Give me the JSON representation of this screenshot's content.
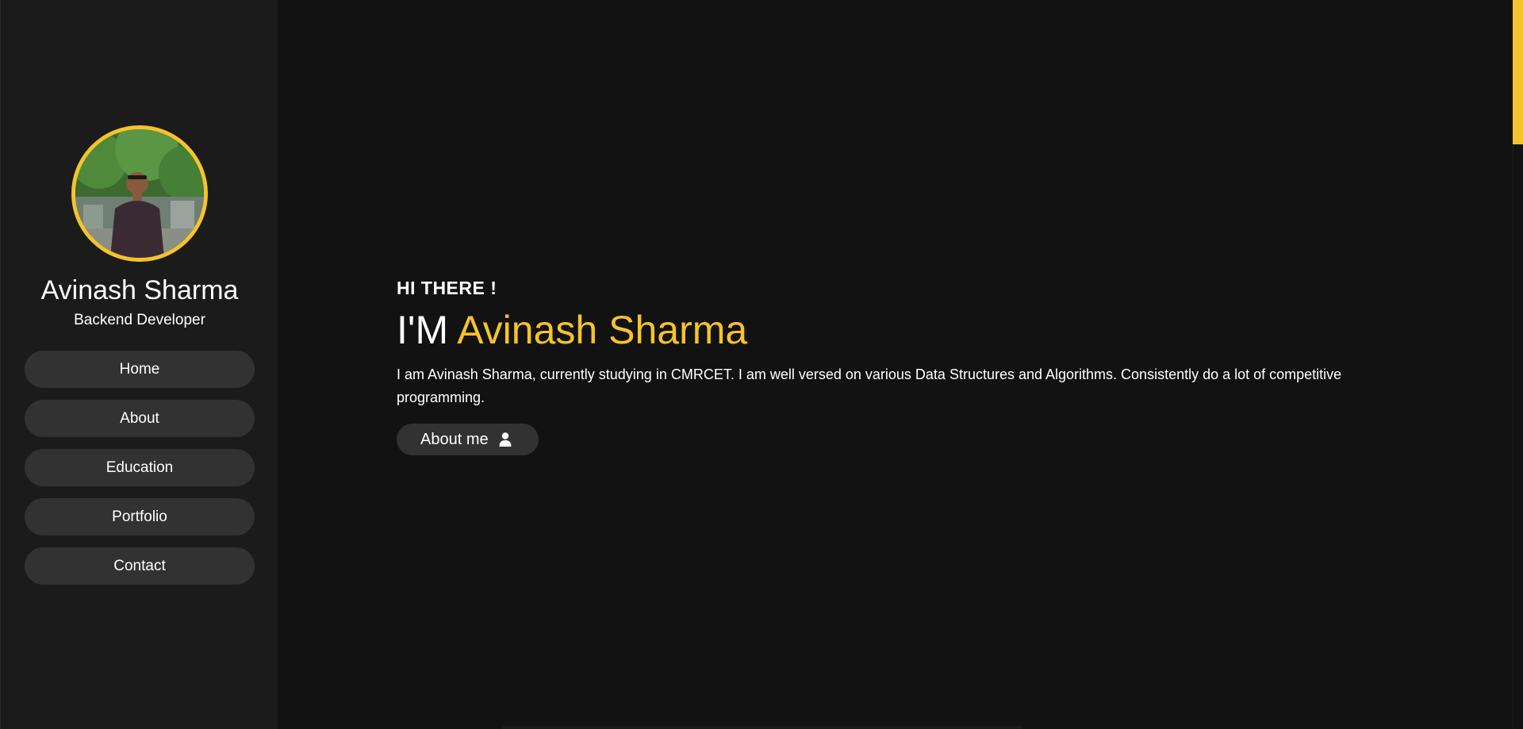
{
  "colors": {
    "accent": "#f5c32c",
    "background": "#121212",
    "sidebar": "#1b1b1b",
    "button": "#323232",
    "text": "#ffffff"
  },
  "sidebar": {
    "avatar_icon": "profile-photo",
    "name": "Avinash Sharma",
    "role": "Backend Developer",
    "nav": [
      {
        "label": "Home"
      },
      {
        "label": "About"
      },
      {
        "label": "Education"
      },
      {
        "label": "Portfolio"
      },
      {
        "label": "Contact"
      }
    ]
  },
  "hero": {
    "greeting": "HI THERE !",
    "headline_prefix": "I'M",
    "headline_name": "Avinash Sharma",
    "intro": "I am Avinash Sharma, currently studying in CMRCET. I am well versed on various Data Structures and Algorithms. Consistently do a lot of competitive programming.",
    "button_label": "About me",
    "button_icon": "user-icon"
  }
}
